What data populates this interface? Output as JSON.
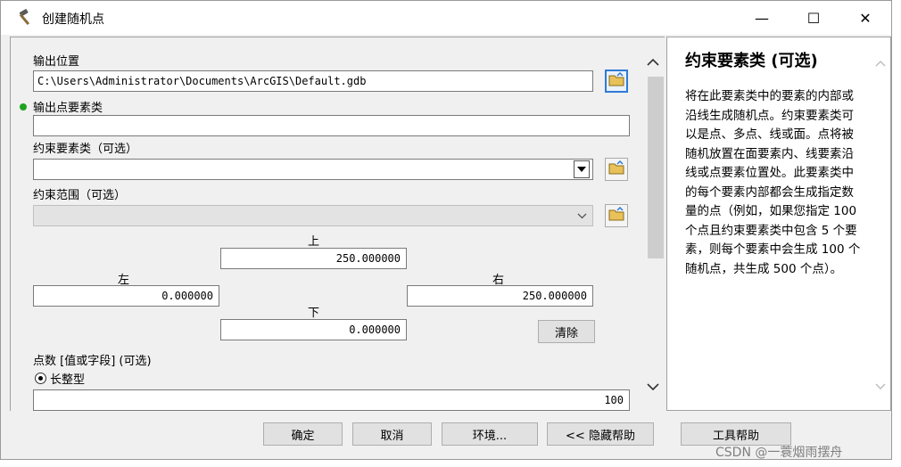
{
  "window": {
    "title": "创建随机点",
    "minimize_glyph": "—",
    "maximize_glyph": "☐",
    "close_glyph": "✕"
  },
  "form": {
    "output_location_label": "输出位置",
    "output_location_value": "C:\\Users\\Administrator\\Documents\\ArcGIS\\Default.gdb",
    "output_point_fc_label": "输出点要素类",
    "output_point_fc_value": "",
    "constraint_fc_label": "约束要素类（可选）",
    "constraint_fc_value": "",
    "constraint_extent_label": "约束范围（可选）",
    "constraint_extent_value": "",
    "extent": {
      "top_label": "上",
      "top_value": "250.000000",
      "left_label": "左",
      "left_value": "0.000000",
      "right_label": "右",
      "right_value": "250.000000",
      "bottom_label": "下",
      "bottom_value": "0.000000",
      "clear_label": "清除"
    },
    "point_count_label": "点数 [值或字段] (可选)",
    "long_type_label": "长整型",
    "point_count_value": "100"
  },
  "help": {
    "title": "约束要素类 (可选)",
    "body": "将在此要素类中的要素的内部或沿线生成随机点。约束要素类可以是点、多点、线或面。点将被随机放置在面要素内、线要素沿线或点要素位置处。此要素类中的每个要素内部都会生成指定数量的点（例如，如果您指定 100 个点且约束要素类中包含 5 个要素，则每个要素中会生成 100 个随机点，共生成 500 个点）。"
  },
  "buttons": {
    "ok": "确定",
    "cancel": "取消",
    "environments": "环境...",
    "hide_help": "<< 隐藏帮助",
    "tool_help": "工具帮助"
  },
  "watermark": "CSDN @一蓑烟雨摆舟",
  "colors": {
    "required_dot": "#1fa31f",
    "active_border": "#2e7bd6"
  }
}
